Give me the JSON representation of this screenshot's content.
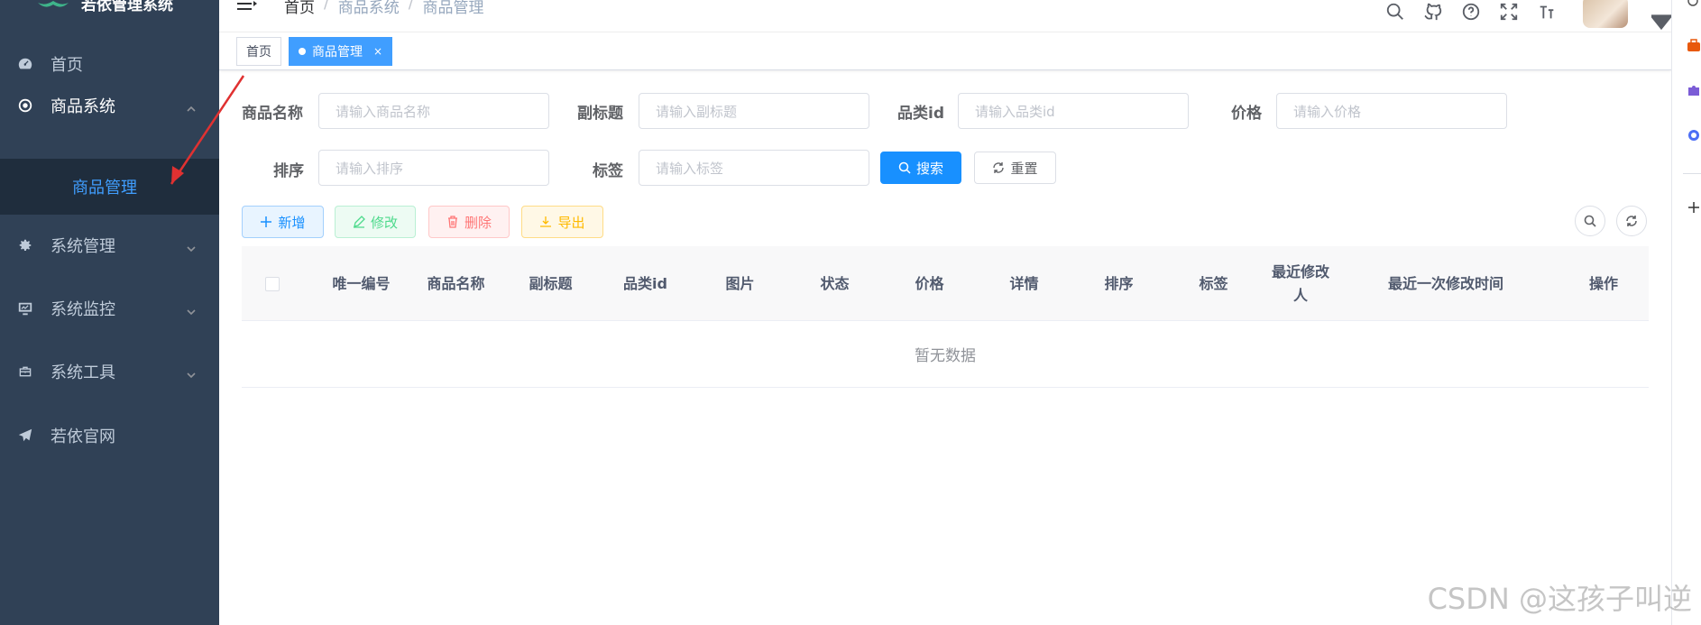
{
  "sidebar": {
    "logo_text": "若依管理系统",
    "items": [
      {
        "label": "首页",
        "icon": "dashboard-icon"
      },
      {
        "label": "商品系统",
        "icon": "radio-icon"
      },
      {
        "label": "系统管理",
        "icon": "gear-icon"
      },
      {
        "label": "系统监控",
        "icon": "monitor-icon"
      },
      {
        "label": "系统工具",
        "icon": "toolbox-icon"
      },
      {
        "label": "若依官网",
        "icon": "paper-plane-icon"
      }
    ],
    "submenu": {
      "label": "商品管理"
    }
  },
  "navbar": {
    "breadcrumb": [
      "首页",
      "商品系统",
      "商品管理"
    ],
    "separator": "/"
  },
  "tags": [
    {
      "label": "首页"
    },
    {
      "label": "商品管理",
      "close": "×"
    }
  ],
  "search_form": {
    "fields": [
      {
        "label": "商品名称",
        "placeholder": "请输入商品名称"
      },
      {
        "label": "副标题",
        "placeholder": "请输入副标题"
      },
      {
        "label": "品类id",
        "placeholder": "请输入品类id"
      },
      {
        "label": "价格",
        "placeholder": "请输入价格"
      },
      {
        "label": "排序",
        "placeholder": "请输入排序"
      },
      {
        "label": "标签",
        "placeholder": "请输入标签"
      }
    ],
    "search_label": "搜索",
    "reset_label": "重置"
  },
  "toolbar": {
    "add_label": "新增",
    "edit_label": "修改",
    "delete_label": "删除",
    "export_label": "导出"
  },
  "table": {
    "columns": [
      "唯一编号",
      "商品名称",
      "副标题",
      "品类id",
      "图片",
      "状态",
      "价格",
      "详情",
      "排序",
      "标签",
      "最近修改人",
      "最近一次修改时间",
      "操作"
    ],
    "empty_text": "暂无数据"
  },
  "watermark": "CSDN @这孩子叫逆",
  "colors": {
    "sidebar_bg": "#304156",
    "submenu_bg": "#1f2d3d",
    "primary": "#1890ff",
    "annotation_arrow": "#e03131"
  }
}
